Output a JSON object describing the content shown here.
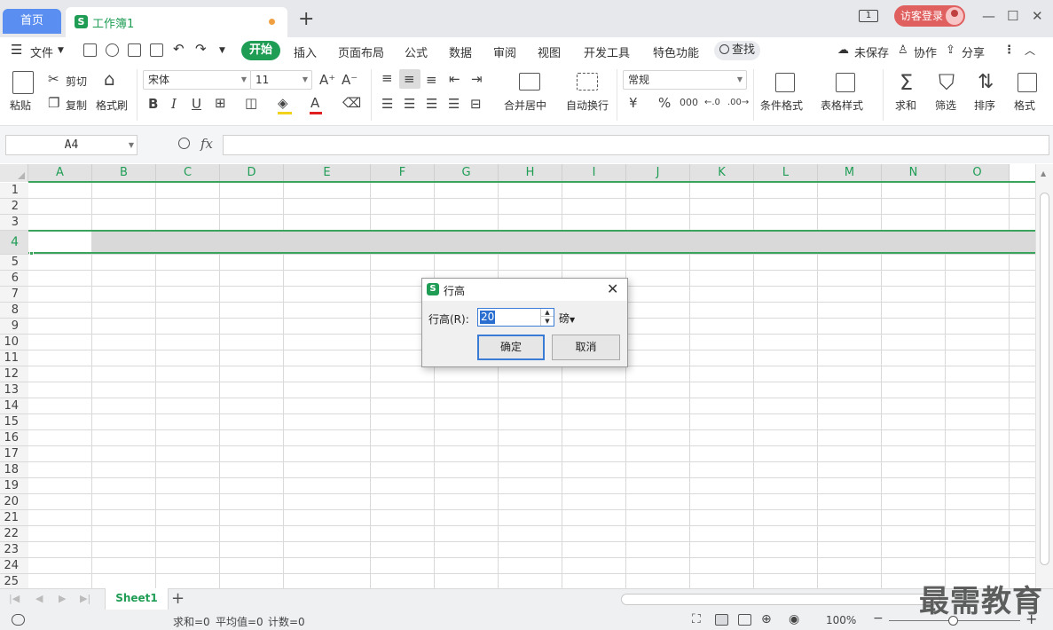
{
  "titlebar": {
    "home_tab": "首页",
    "doc_tab": "工作簿1",
    "doc_logo": "S",
    "add_tab": "+",
    "page_indicator": "1",
    "login": "访客登录",
    "minimize": "—",
    "maximize": "☐",
    "close": "✕"
  },
  "menu": {
    "file": "文件",
    "start": "开始",
    "items": [
      "插入",
      "页面布局",
      "公式",
      "数据",
      "审阅",
      "视图",
      "开发工具",
      "特色功能"
    ],
    "search": "查找",
    "unsaved": "未保存",
    "collab": "协作",
    "share": "分享"
  },
  "ribbon": {
    "paste": "粘贴",
    "cut": "剪切",
    "copy": "复制",
    "format_painter": "格式刷",
    "font_name": "宋体",
    "font_size": "11",
    "bold": "B",
    "italic": "I",
    "underline": "U",
    "merge_center": "合并居中",
    "wrap_text": "自动换行",
    "number_format": "常规",
    "currency": "¥",
    "percent": "%",
    "thousands": "000",
    "conditional_format": "条件格式",
    "table_style": "表格样式",
    "sum": "求和",
    "filter": "筛选",
    "sort": "排序",
    "format": "格式"
  },
  "formula_bar": {
    "name_box": "A4",
    "fx": "fx",
    "value": ""
  },
  "grid": {
    "columns": [
      "A",
      "B",
      "C",
      "D",
      "E",
      "F",
      "G",
      "H",
      "I",
      "J",
      "K",
      "L",
      "M",
      "N",
      "O"
    ],
    "rows": [
      "1",
      "2",
      "3",
      "4",
      "5",
      "6",
      "7",
      "8",
      "9",
      "10",
      "11",
      "12",
      "13",
      "14",
      "15",
      "16",
      "17",
      "18",
      "19",
      "20",
      "21",
      "22",
      "23",
      "24",
      "25"
    ],
    "selected_row": "4"
  },
  "sheets": {
    "active": "Sheet1",
    "add": "+"
  },
  "status": {
    "sum": "求和=0",
    "average": "平均值=0",
    "count": "计数=0",
    "zoom": "100%",
    "zoom_level": 100
  },
  "dialog": {
    "logo": "S",
    "title": "行高",
    "label": "行高(R):",
    "value": "20",
    "unit": "磅",
    "ok": "确定",
    "cancel": "取消",
    "close": "✕"
  },
  "watermark": "最需教育",
  "colors": {
    "accent": "#1f9d55",
    "home_tab": "#5a8ef0",
    "login": "#e06060",
    "selection": "#3aa45c",
    "focus": "#3a7bd5"
  }
}
